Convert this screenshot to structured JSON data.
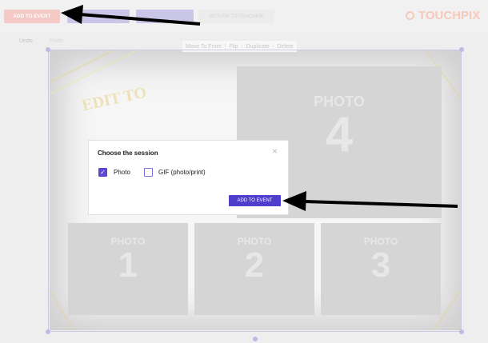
{
  "header": {
    "add_to_event_label": "ADD TO EVENT",
    "return_label": "RETURN TO TOUCHPIX",
    "logo_text": "TOUCHPIX"
  },
  "editor": {
    "undo_label": "Undo",
    "redo_label": "Redo",
    "toolbar": {
      "move_to_front": "Move To Front",
      "flip": "Flip",
      "duplicate": "Duplicate",
      "delete": "Delete"
    }
  },
  "template": {
    "decorative_text_1": "EDIT TO",
    "photos": [
      {
        "label": "PHOTO",
        "number": "4"
      },
      {
        "label": "PHOTO",
        "number": "1"
      },
      {
        "label": "PHOTO",
        "number": "2"
      },
      {
        "label": "PHOTO",
        "number": "3"
      }
    ]
  },
  "modal": {
    "title": "Choose the session",
    "close_glyph": "×",
    "checkmark_glyph": "✓",
    "options": [
      {
        "label": "Photo",
        "checked": true
      },
      {
        "label": "GIF (photo/print)",
        "checked": false
      }
    ],
    "confirm_label": "ADD TO EVENT"
  },
  "colors": {
    "accent": "#4f3dcc",
    "faded_red": "#f0b6b2",
    "logo": "#f3b5a0"
  }
}
